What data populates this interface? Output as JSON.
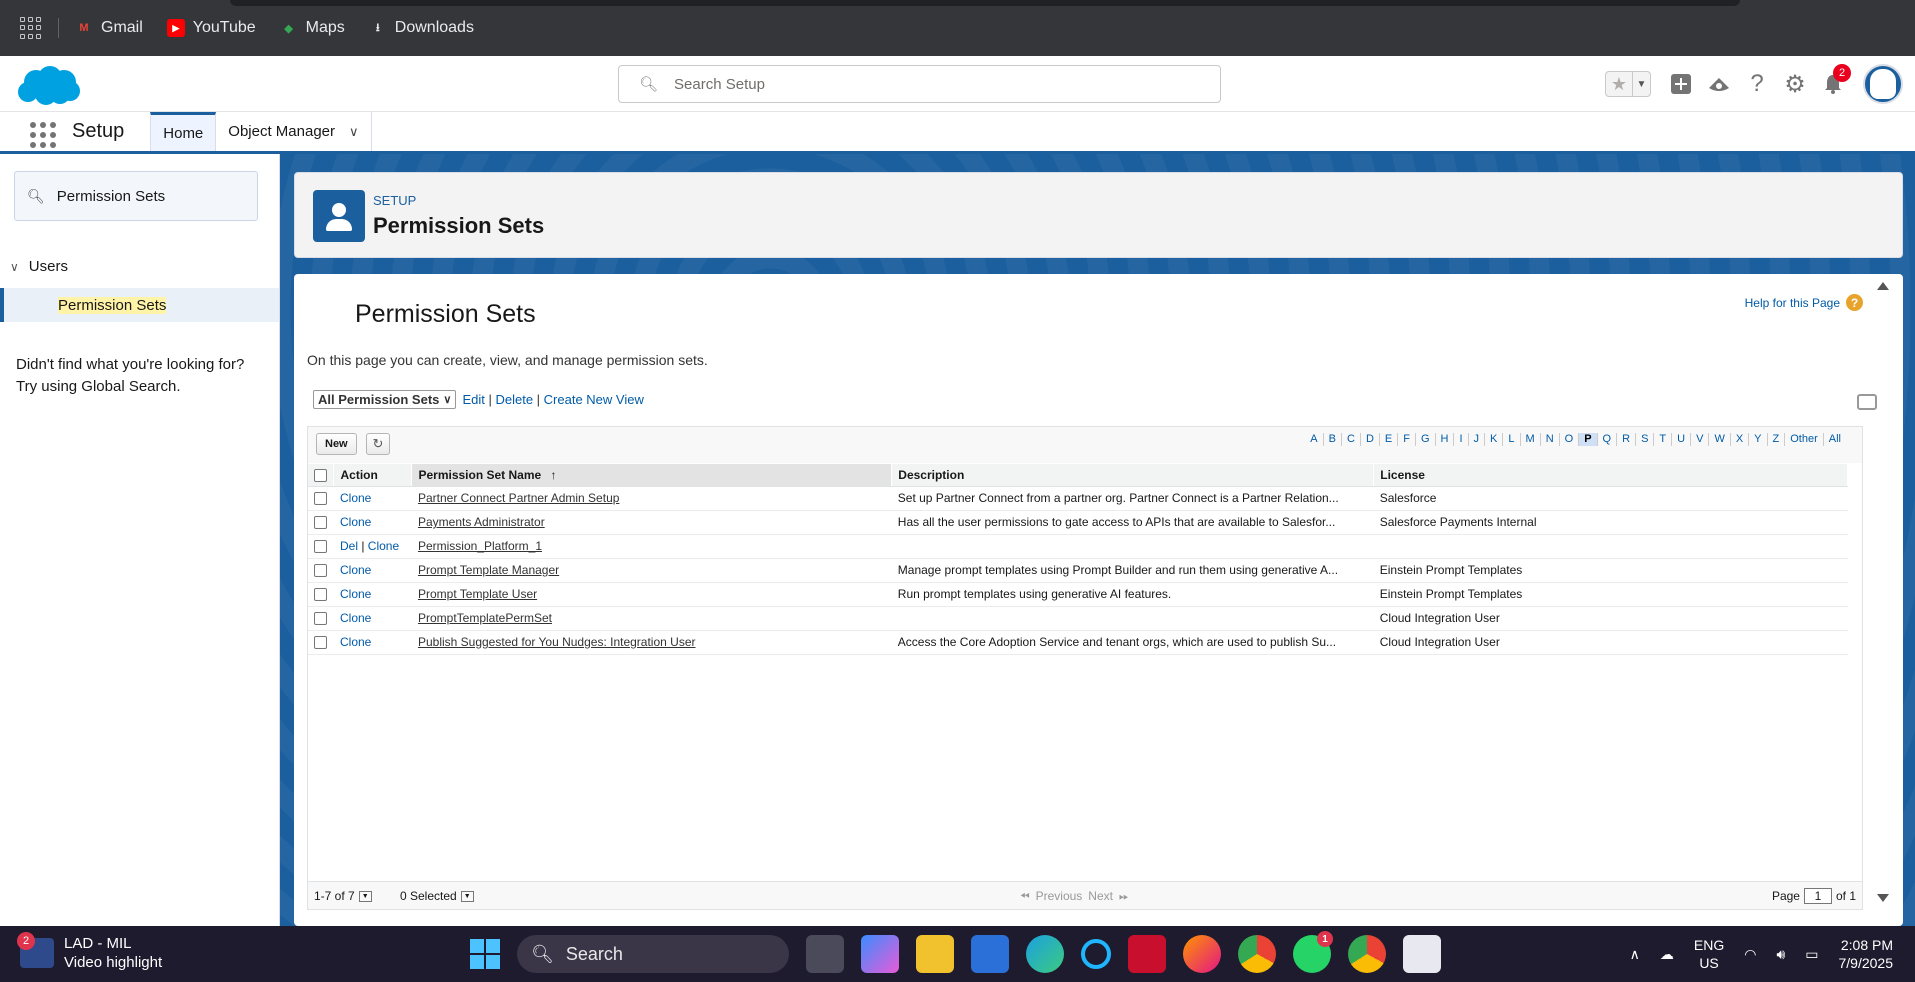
{
  "bookmarks": {
    "items": [
      {
        "label": "Gmail",
        "icon": "gmail-icon"
      },
      {
        "label": "YouTube",
        "icon": "youtube-icon"
      },
      {
        "label": "Maps",
        "icon": "maps-icon"
      },
      {
        "label": "Downloads",
        "icon": "download-icon"
      }
    ]
  },
  "header": {
    "search_placeholder": "Search Setup",
    "notification_count": "2"
  },
  "nav": {
    "app_name": "Setup",
    "tabs": [
      {
        "label": "Home"
      },
      {
        "label": "Object Manager"
      }
    ]
  },
  "sidebar": {
    "quick_find_value": "Permission Sets",
    "tree_parent": "Users",
    "tree_child": "Permission Sets",
    "not_found_line1": "Didn't find what you're looking for?",
    "not_found_line2": "Try using Global Search."
  },
  "page_header": {
    "eyebrow": "SETUP",
    "title": "Permission Sets"
  },
  "content": {
    "title": "Permission Sets",
    "help_link": "Help for this Page",
    "description": "On this page you can create, view, and manage permission sets.",
    "view_selected": "All Permission Sets",
    "view_links": {
      "edit": "Edit",
      "delete": "Delete",
      "create": "Create New View"
    },
    "new_button": "New",
    "alphabet": [
      "A",
      "B",
      "C",
      "D",
      "E",
      "F",
      "G",
      "H",
      "I",
      "J",
      "K",
      "L",
      "M",
      "N",
      "O",
      "P",
      "Q",
      "R",
      "S",
      "T",
      "U",
      "V",
      "W",
      "X",
      "Y",
      "Z",
      "Other",
      "All"
    ],
    "alphabet_selected": "P",
    "columns": {
      "action": "Action",
      "name": "Permission Set Name",
      "description": "Description",
      "license": "License"
    },
    "rows": [
      {
        "action_del": "",
        "action_clone": "Clone",
        "name": "Partner Connect Partner Admin Setup",
        "description": "Set up Partner Connect from a partner org. Partner Connect is a Partner Relation...",
        "license": "Salesforce"
      },
      {
        "action_del": "",
        "action_clone": "Clone",
        "name": "Payments Administrator",
        "description": "Has all the user permissions to gate access to APIs that are available to Salesfor...",
        "license": "Salesforce Payments Internal"
      },
      {
        "action_del": "Del",
        "action_clone": "Clone",
        "name": "Permission_Platform_1",
        "description": "",
        "license": ""
      },
      {
        "action_del": "",
        "action_clone": "Clone",
        "name": "Prompt Template Manager",
        "description": "Manage prompt templates using Prompt Builder and run them using generative A...",
        "license": "Einstein Prompt Templates"
      },
      {
        "action_del": "",
        "action_clone": "Clone",
        "name": "Prompt Template User",
        "description": "Run prompt templates using generative AI features.",
        "license": "Einstein Prompt Templates"
      },
      {
        "action_del": "",
        "action_clone": "Clone",
        "name": "PromptTemplatePermSet",
        "description": "",
        "license": "Cloud Integration User"
      },
      {
        "action_del": "",
        "action_clone": "Clone",
        "name": "Publish Suggested for You Nudges: Integration User",
        "description": "Access the Core Adoption Service and tenant orgs, which are used to publish Su...",
        "license": "Cloud Integration User"
      }
    ],
    "footer": {
      "count": "1-7 of 7",
      "selected": "0 Selected",
      "previous": "Previous",
      "next": "Next",
      "page_label": "Page",
      "page_value": "1",
      "page_of": "of 1"
    }
  },
  "taskbar": {
    "widget_badge": "2",
    "widget_title": "LAD - MIL",
    "widget_subtitle": "Video highlight",
    "search_label": "Search",
    "whatsapp_badge": "1",
    "lang_line1": "ENG",
    "lang_line2": "US",
    "time": "2:08 PM",
    "date": "7/9/2025"
  },
  "colors": {
    "brand": "#1b5f9e",
    "link": "#015ba7",
    "salesforce_cloud": "#00a1e0"
  }
}
